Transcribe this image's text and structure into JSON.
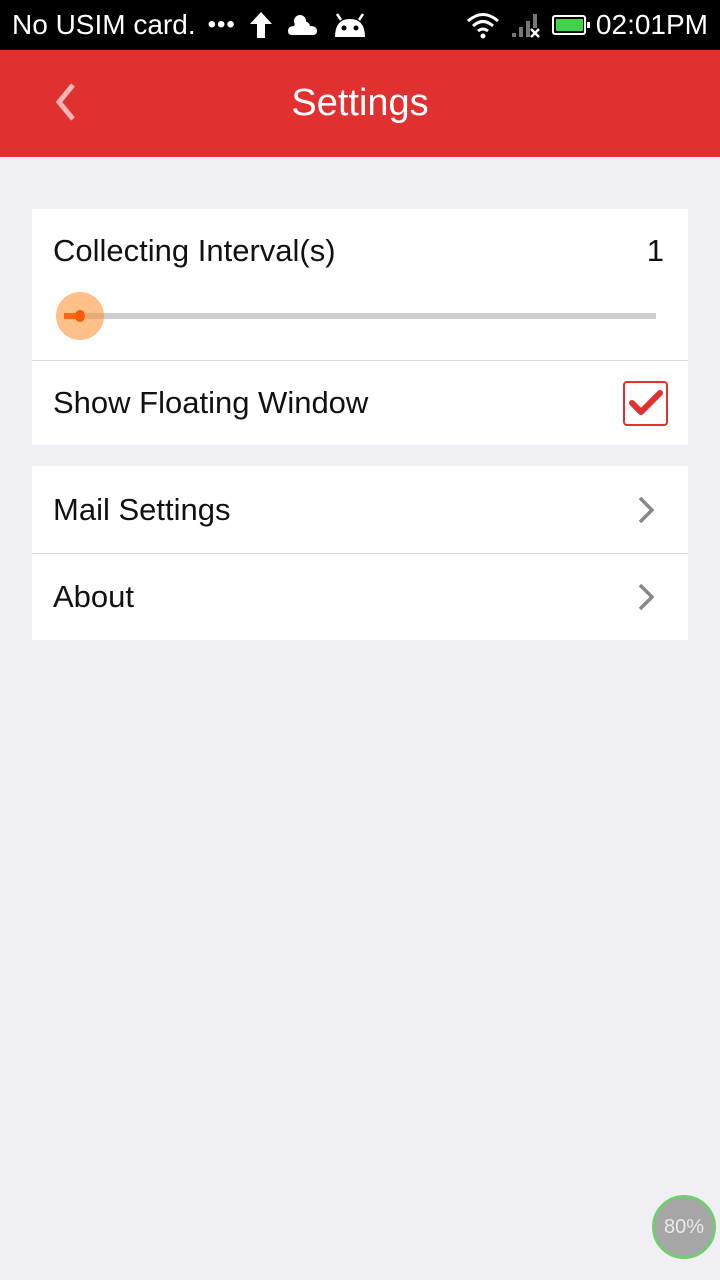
{
  "status_bar": {
    "carrier": "No USIM card.",
    "dots": "•••",
    "time": "02:01PM",
    "battery_level": 0.95,
    "icons": [
      "upload-arrow-icon",
      "weather-cloud-icon",
      "android-icon",
      "wifi-icon",
      "signal-no-sim-icon",
      "battery-icon"
    ]
  },
  "app_bar": {
    "title": "Settings",
    "back_icon": "chevron-left-icon",
    "color": "#e03030"
  },
  "settings": {
    "interval": {
      "label": "Collecting Interval(s)",
      "value": "1",
      "slider_fraction": 0.02
    },
    "floating_window": {
      "label": "Show Floating Window",
      "checked": true
    },
    "mail": {
      "label": "Mail Settings"
    },
    "about": {
      "label": "About"
    }
  },
  "memory_badge": {
    "text": "80%"
  },
  "colors": {
    "accent": "#e03030",
    "slider_fill": "#ff3b00",
    "background": "#efeff4"
  }
}
